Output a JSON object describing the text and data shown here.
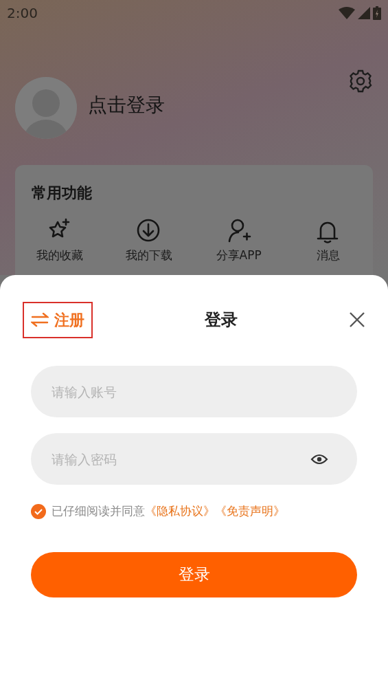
{
  "status_bar": {
    "time": "2:00"
  },
  "profile": {
    "name": "点击登录"
  },
  "common_functions": {
    "title": "常用功能",
    "items": [
      {
        "label": "我的收藏",
        "kind": "star"
      },
      {
        "label": "我的下载",
        "kind": "download"
      },
      {
        "label": "分享APP",
        "kind": "add-user"
      },
      {
        "label": "消息",
        "kind": "bell"
      }
    ]
  },
  "login_sheet": {
    "register_link": "注册",
    "title": "登录",
    "fields": [
      {
        "placeholder": "请输入账号",
        "kind": "text"
      },
      {
        "placeholder": "请输入密码",
        "kind": "password"
      }
    ],
    "agreement": {
      "checked": true,
      "text": "已仔细阅读并同意",
      "links": [
        "《隐私协议》",
        "《免责声明》"
      ]
    },
    "submit": "登录"
  }
}
